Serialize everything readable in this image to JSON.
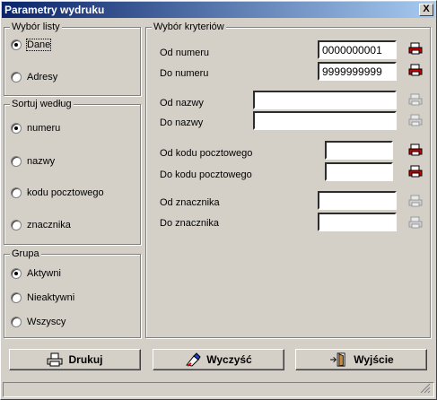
{
  "window": {
    "title": "Parametry wydruku",
    "close_label": "X"
  },
  "wybor_listy": {
    "legend": "Wybór listy",
    "options": [
      {
        "label": "Dane",
        "checked": true
      },
      {
        "label": "Adresy",
        "checked": false
      }
    ]
  },
  "sortuj": {
    "legend": "Sortuj według",
    "options": [
      {
        "label": "numeru",
        "checked": true
      },
      {
        "label": "nazwy",
        "checked": false
      },
      {
        "label": "kodu pocztowego",
        "checked": false
      },
      {
        "label": "znacznika",
        "checked": false
      }
    ]
  },
  "grupa": {
    "legend": "Grupa",
    "options": [
      {
        "label": "Aktywni",
        "checked": true
      },
      {
        "label": "Nieaktywni",
        "checked": false
      },
      {
        "label": "Wszyscy",
        "checked": false
      }
    ]
  },
  "kryteria": {
    "legend": "Wybór kryteriów",
    "od_numeru": {
      "label": "Od numeru",
      "value": "0000000001",
      "picker_icon": "picker-active-icon"
    },
    "do_numeru": {
      "label": "Do numeru",
      "value": "9999999999",
      "picker_icon": "picker-active-icon"
    },
    "od_nazwy": {
      "label": "Od nazwy",
      "value": "",
      "picker_icon": "picker-disabled-icon"
    },
    "do_nazwy": {
      "label": "Do nazwy",
      "value": "",
      "picker_icon": "picker-disabled-icon"
    },
    "od_kodu": {
      "label": "Od kodu pocztowego",
      "value": "",
      "picker_icon": "picker-active-icon"
    },
    "do_kodu": {
      "label": "Do kodu pocztowego",
      "value": "",
      "picker_icon": "picker-active-icon"
    },
    "od_znacznika": {
      "label": "Od znacznika",
      "value": "",
      "picker_icon": "picker-disabled-icon"
    },
    "do_znacznika": {
      "label": "Do znacznika",
      "value": "",
      "picker_icon": "picker-disabled-icon"
    }
  },
  "buttons": {
    "print": {
      "label": "Drukuj",
      "icon": "printer-icon"
    },
    "clear": {
      "label": "Wyczyść",
      "icon": "eraser-icon"
    },
    "exit": {
      "label": "Wyjście",
      "icon": "exit-door-icon"
    }
  },
  "colors": {
    "titlebar_start": "#0a246a",
    "titlebar_end": "#a6caf0",
    "face": "#d4d0c8",
    "picker_red": "#cc0000"
  }
}
